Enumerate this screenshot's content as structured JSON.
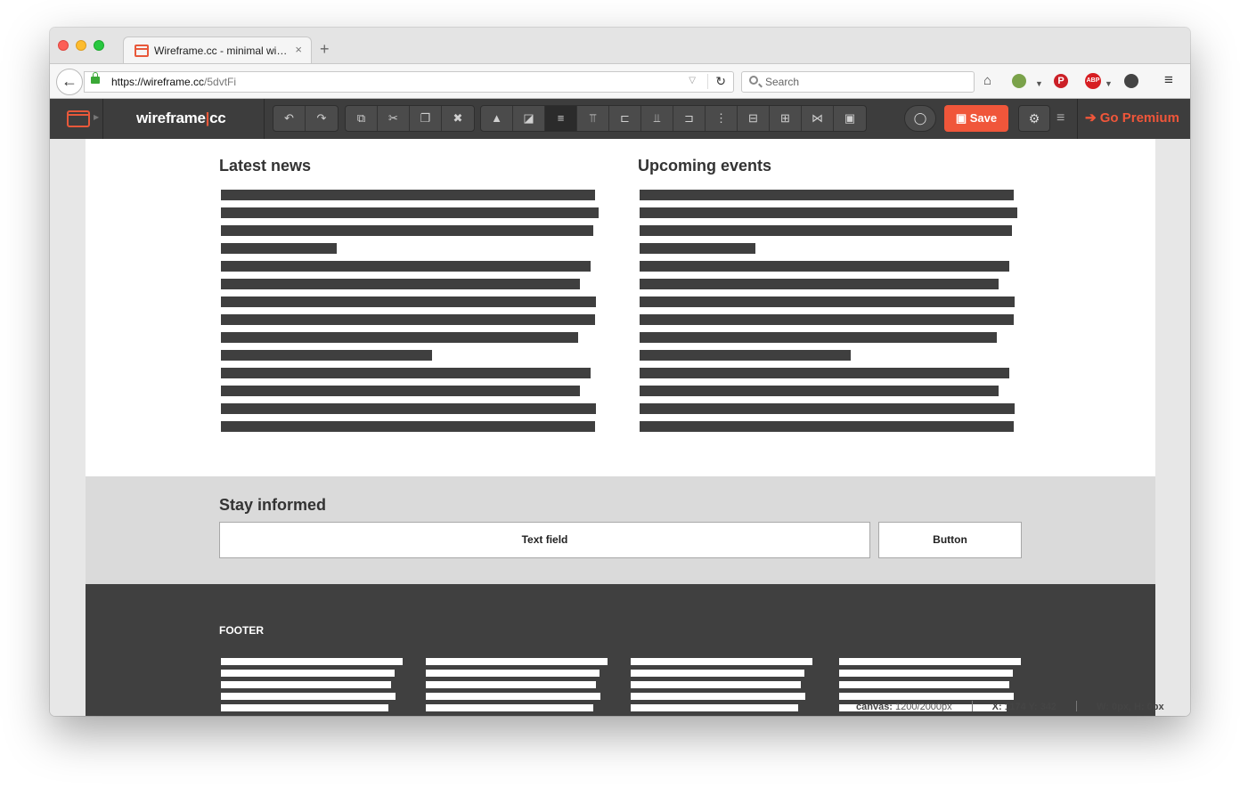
{
  "browser": {
    "tab_title": "Wireframe.cc - minimal wire…",
    "tab_close": "×",
    "new_tab": "+",
    "url_host": "https://wireframe.cc",
    "url_path": "/5dvtFi",
    "search_placeholder": "Search",
    "menu_glyph": "≡"
  },
  "app": {
    "brand_left": "wireframe",
    "brand_sep": "|",
    "brand_right": "cc",
    "save_label": "Save",
    "premium_label": "Go Premium",
    "toolbar_groups": [
      [
        "undo-icon",
        "redo-icon"
      ],
      [
        "duplicate-icon",
        "cut-icon",
        "paste-icon",
        "delete-icon"
      ],
      [
        "lock-icon",
        "arrange-icon",
        "align-text-icon",
        "align-top-icon",
        "align-left-icon",
        "align-bottom-icon",
        "align-right-icon",
        "align-center-vertical-icon",
        "align-center-horizontal-icon",
        "distribute-vertical-icon",
        "distribute-horizontal-icon",
        "group-icon"
      ]
    ],
    "toolbar_glyphs": {
      "undo-icon": "↶",
      "redo-icon": "↷",
      "duplicate-icon": "⧉",
      "cut-icon": "✂",
      "paste-icon": "❐",
      "delete-icon": "✖",
      "lock-icon": "🔒",
      "arrange-icon": "◪",
      "align-text-icon": "≡",
      "align-top-icon": "⫪",
      "align-left-icon": "⊏",
      "align-bottom-icon": "⫫",
      "align-right-icon": "⊐",
      "align-center-vertical-icon": "⋮",
      "align-center-horizontal-icon": "⊟",
      "distribute-vertical-icon": "⊞",
      "distribute-horizontal-icon": "⋈",
      "group-icon": "▣"
    },
    "accent_color": "#f0563a"
  },
  "wireframe": {
    "news_title": "Latest news",
    "events_title": "Upcoming events",
    "news_lines": [
      420,
      424,
      418,
      130,
      415,
      403,
      421,
      420,
      401,
      237,
      415,
      403,
      421,
      420
    ],
    "events_lines": [
      420,
      424,
      418,
      130,
      415,
      403,
      421,
      420,
      401,
      237,
      415,
      403,
      421,
      420
    ],
    "subscribe_title": "Stay informed",
    "text_field_label": "Text field",
    "button_label": "Button",
    "footer_title": "FOOTER",
    "footer_columns": [
      [
        204,
        195,
        191,
        196,
        188,
        204
      ],
      [
        204,
        195,
        191,
        196,
        188,
        204
      ],
      [
        204,
        195,
        191,
        196,
        188,
        204
      ],
      [
        204,
        195,
        191,
        196,
        188,
        204
      ]
    ]
  },
  "status": {
    "canvas_label": "canvas:",
    "canvas_value": "1200/2000px",
    "coords_label": "X: 1174 Y: 342",
    "size_label": "W: 0px, H: 0px"
  }
}
